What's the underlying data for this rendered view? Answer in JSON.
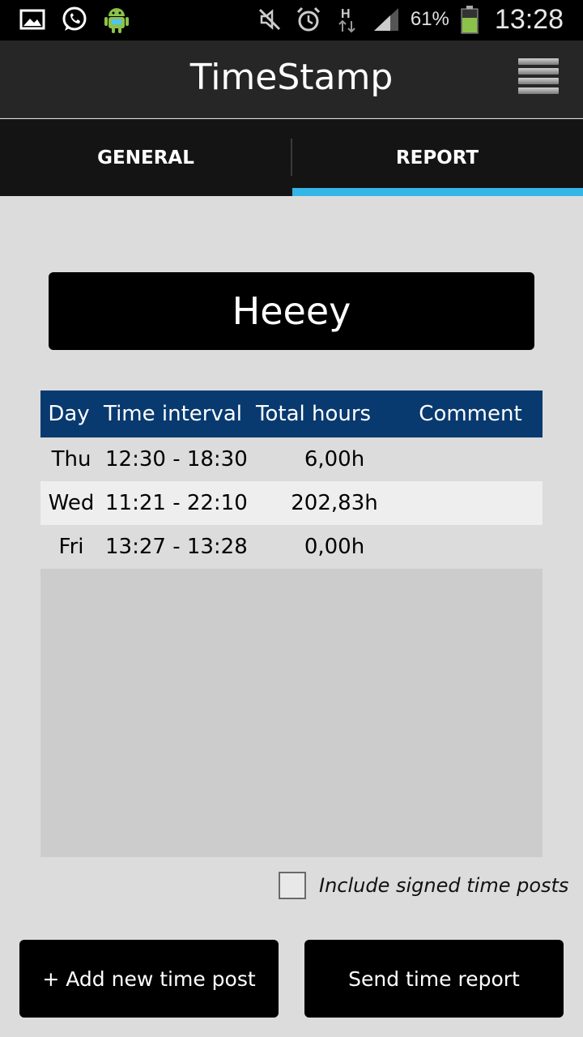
{
  "status_bar": {
    "icons_left": [
      "image-icon",
      "whatsapp-icon",
      "android-icon"
    ],
    "icons_right": [
      "mute-icon",
      "alarm-icon",
      "network-h-icon",
      "signal-icon",
      "battery-icon"
    ],
    "battery_percent": "61%",
    "clock": "13:28"
  },
  "app_bar": {
    "title": "TimeStamp"
  },
  "tabs": [
    {
      "label": "GENERAL",
      "active": false
    },
    {
      "label": "REPORT",
      "active": true
    }
  ],
  "report": {
    "title": "Heeey",
    "table": {
      "headers": {
        "day": "Day",
        "interval": "Time interval",
        "hours": "Total hours",
        "comment": "Comment"
      },
      "rows": [
        {
          "day": "Thu",
          "interval": "12:30 - 18:30",
          "hours": "6,00h",
          "comment": ""
        },
        {
          "day": "Wed",
          "interval": "11:21 - 22:10",
          "hours": "202,83h",
          "comment": ""
        },
        {
          "day": "Fri",
          "interval": "13:27 - 13:28",
          "hours": "0,00h",
          "comment": ""
        }
      ]
    },
    "include_signed_label": "Include signed time posts",
    "include_signed_checked": false
  },
  "buttons": {
    "add_label": "+ Add new time post",
    "send_label": "Send time report"
  },
  "colors": {
    "accent": "#33b5e5",
    "table_header": "#083a70",
    "background": "#dcdcdc"
  }
}
